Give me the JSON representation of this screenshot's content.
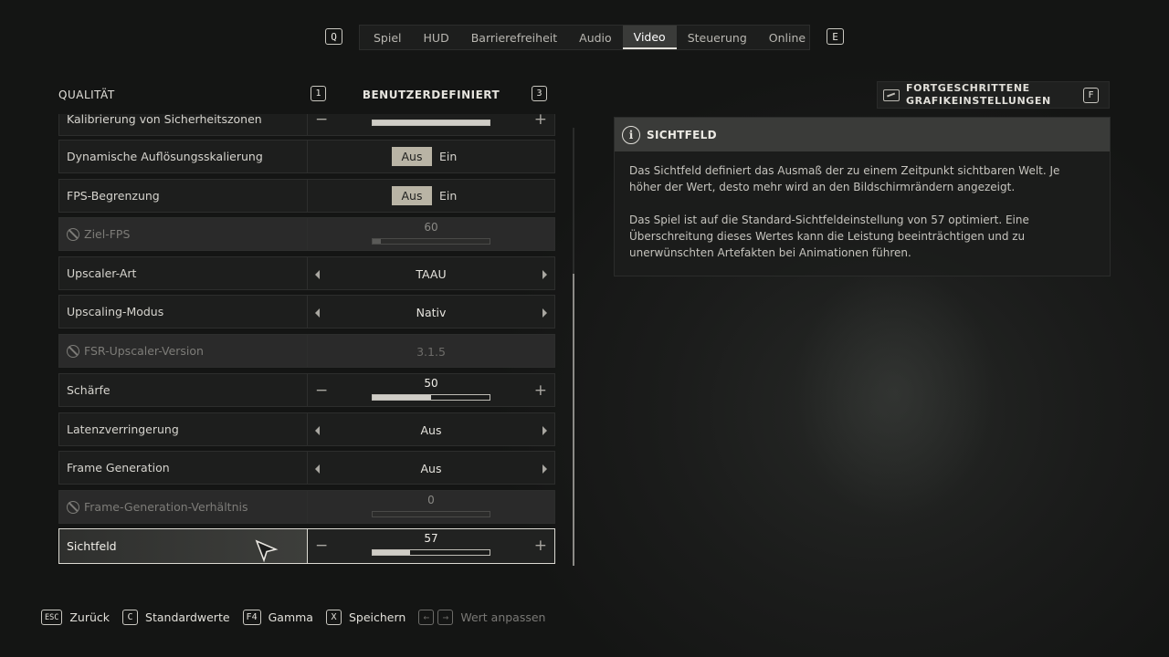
{
  "top_nav": {
    "prev_key": "Q",
    "next_key": "E",
    "tabs": [
      {
        "label": "Spiel"
      },
      {
        "label": "HUD"
      },
      {
        "label": "Barrierefreiheit"
      },
      {
        "label": "Audio"
      },
      {
        "label": "Video",
        "active": true
      },
      {
        "label": "Steuerung"
      },
      {
        "label": "Online"
      }
    ]
  },
  "quality": {
    "label": "QUALITÄT",
    "prev_key": "1",
    "next_key": "3",
    "value": "BENUTZERDEFINIERT"
  },
  "settings": {
    "rows": [
      {
        "label": "Kalibrierung von Sicherheitszonen",
        "type": "slider",
        "value": "",
        "fill_pct": 100
      },
      {
        "label": "Dynamische Auflösungsskalierung",
        "type": "toggle",
        "off_label": "Aus",
        "on_label": "Ein",
        "selected": "Aus"
      },
      {
        "label": "FPS-Begrenzung",
        "type": "toggle",
        "off_label": "Aus",
        "on_label": "Ein",
        "selected": "Aus"
      },
      {
        "label": "Ziel-FPS",
        "type": "slider",
        "value": "60",
        "fill_pct": 7,
        "disabled": true
      },
      {
        "label": "Upscaler-Art",
        "type": "selector",
        "value": "TAAU"
      },
      {
        "label": "Upscaling-Modus",
        "type": "selector",
        "value": "Nativ"
      },
      {
        "label": "FSR-Upscaler-Version",
        "type": "selector",
        "value": "3.1.5",
        "disabled": true
      },
      {
        "label": "Schärfe",
        "type": "slider",
        "value": "50",
        "fill_pct": 50
      },
      {
        "label": "Latenzverringerung",
        "type": "selector",
        "value": "Aus"
      },
      {
        "label": "Frame Generation",
        "type": "selector",
        "value": "Aus"
      },
      {
        "label": "Frame-Generation-Verhältnis",
        "type": "slider",
        "value": "0",
        "fill_pct": 0,
        "disabled": true
      },
      {
        "label": "Sichtfeld",
        "type": "slider",
        "value": "57",
        "fill_pct": 32,
        "selected": true
      }
    ]
  },
  "advanced": {
    "line1": "FORTGESCHRITTENE",
    "line2": "GRAFIKEINSTELLUNGEN",
    "key": "F"
  },
  "info_panel": {
    "title": "SICHTFELD",
    "paragraphs": [
      "Das Sichtfeld definiert das Ausmaß der zu einem Zeitpunkt sichtbaren Welt. Je höher der Wert, desto mehr wird an den Bildschirmrändern angezeigt.",
      "Das Spiel ist auf die Standard-Sichtfeldeinstellung von 57 optimiert. Eine Überschreitung dieses Wertes kann die Leistung beeinträchtigen und zu unerwünschten Artefakten bei Animationen führen."
    ]
  },
  "footer": {
    "back": {
      "key": "ESC",
      "label": "Zurück"
    },
    "defaults": {
      "key": "C",
      "label": "Standardwerte"
    },
    "gamma": {
      "key": "F4",
      "label": "Gamma"
    },
    "save": {
      "key": "X",
      "label": "Speichern"
    },
    "adjust": {
      "key_left": "←",
      "key_right": "→",
      "label": "Wert anpassen"
    }
  },
  "colors": {
    "background": "#151615",
    "row_bg": "#1e1f1e",
    "tab_active_bg": "#3a3b39",
    "toggle_on_bg": "#b9b4a5",
    "text": "#d8d6d0"
  }
}
